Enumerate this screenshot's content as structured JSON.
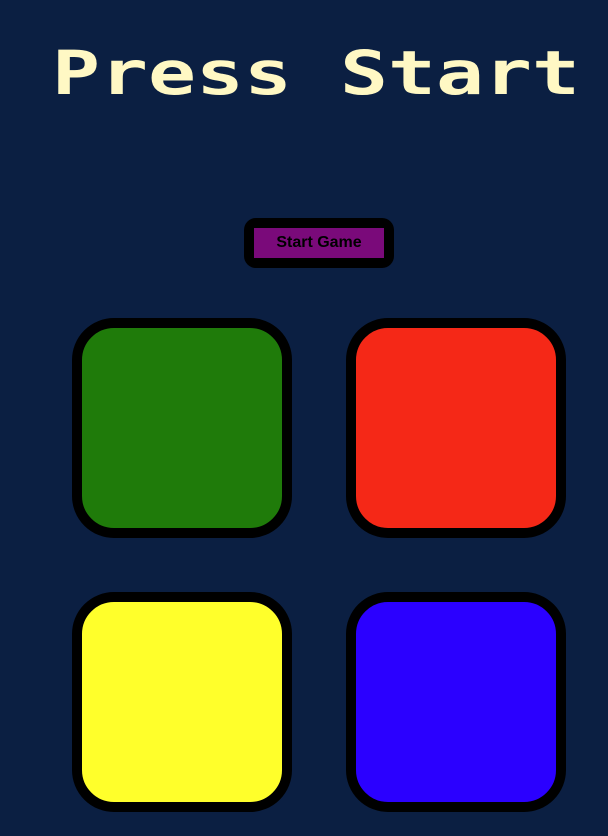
{
  "header": {
    "title": "Press Start",
    "title_color": "#fff8c4"
  },
  "controls": {
    "start_button_label": "Start Game",
    "start_button_color": "#7a0a7a"
  },
  "pads": [
    {
      "name": "green",
      "color": "#1f7b0a"
    },
    {
      "name": "red",
      "color": "#f52817"
    },
    {
      "name": "yellow",
      "color": "#ffff2b"
    },
    {
      "name": "blue",
      "color": "#2b00ff"
    }
  ],
  "theme": {
    "background": "#0b1f42",
    "border": "#000000"
  }
}
